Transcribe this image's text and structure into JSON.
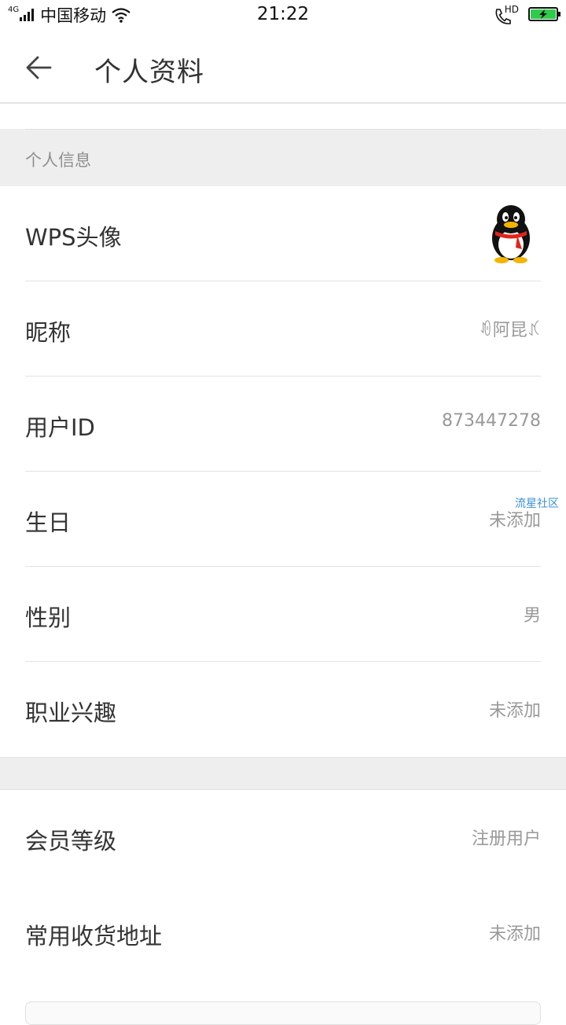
{
  "status_bar": {
    "network": "4G",
    "carrier": "中国移动",
    "time": "21:22",
    "call_badge": "HD",
    "icons": [
      "signal-icon",
      "wifi-icon",
      "hd-call-icon",
      "battery-charging-icon"
    ]
  },
  "header": {
    "title": "个人资料",
    "back_icon": "arrow-left-icon"
  },
  "section": {
    "label": "个人信息"
  },
  "rows": [
    {
      "label": "WPS头像",
      "value": ""
    },
    {
      "label": "昵称",
      "value": "ꀑ阿昆ꃤ"
    },
    {
      "label": "用户ID",
      "value": "873447278"
    },
    {
      "label": "生日",
      "value": "未添加"
    },
    {
      "label": "性别",
      "value": "男"
    },
    {
      "label": "职业兴趣",
      "value": "未添加"
    }
  ],
  "rows2": [
    {
      "label": "会员等级",
      "value": "注册用户"
    },
    {
      "label": "常用收货地址",
      "value": "未添加"
    }
  ],
  "watermark": "流星社区",
  "colors": {
    "section_bg": "#eeeeee",
    "label_text": "#333333",
    "value_text": "#999999",
    "battery_fill": "#2ecc4a",
    "watermark": "#3a8fd6"
  }
}
